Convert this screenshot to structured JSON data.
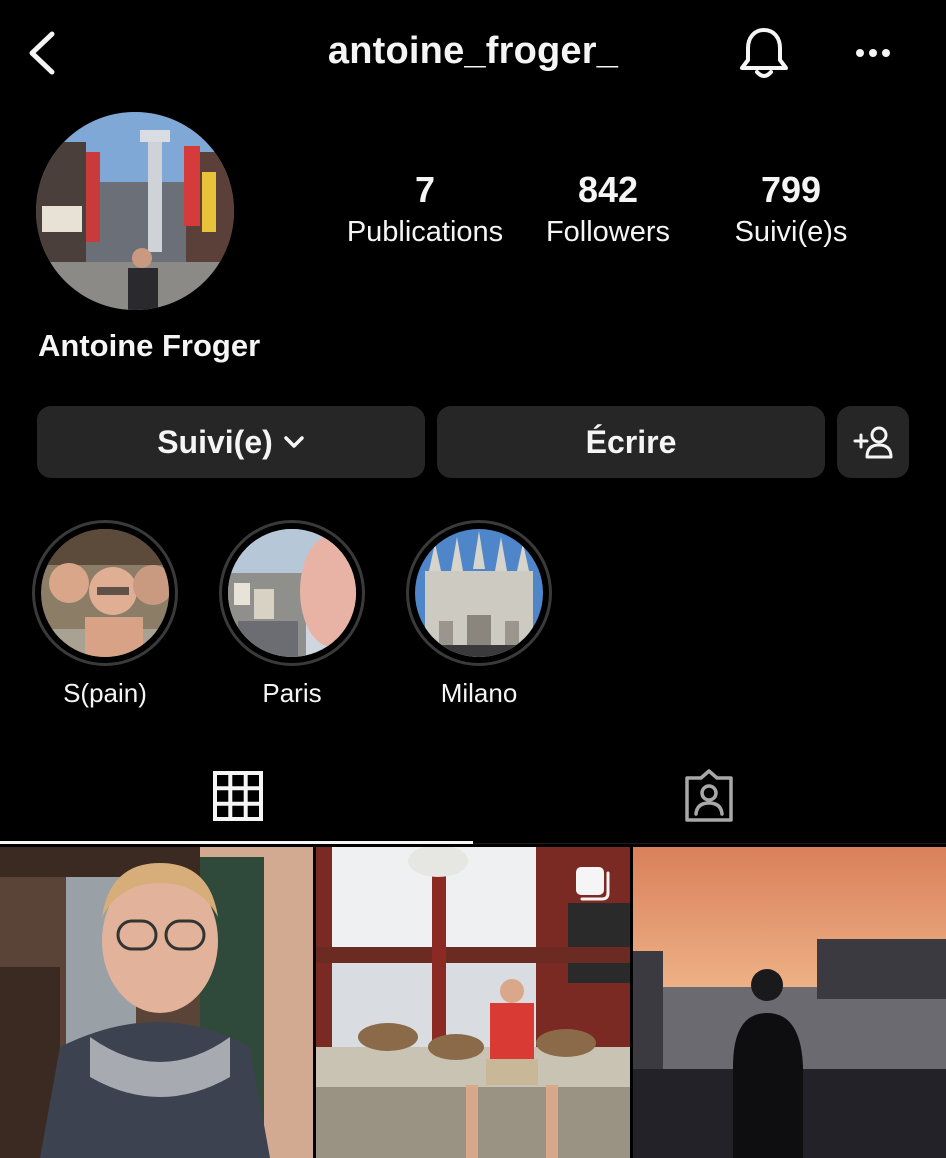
{
  "header": {
    "username": "antoine_froger_",
    "back_icon": "chevron-left-icon",
    "bell_icon": "bell-icon",
    "more_icon": "more-horizontal-icon"
  },
  "profile": {
    "display_name": "Antoine Froger",
    "stats": [
      {
        "value": "7",
        "label": "Publications"
      },
      {
        "value": "842",
        "label": "Followers"
      },
      {
        "value": "799",
        "label": "Suivi(e)s"
      }
    ]
  },
  "actions": {
    "follow_label": "Suivi(e)",
    "message_label": "Écrire",
    "add_user_icon": "add-user-icon"
  },
  "highlights": [
    {
      "label": "S(pain)"
    },
    {
      "label": "Paris"
    },
    {
      "label": "Milano"
    }
  ],
  "tabs": [
    {
      "icon": "grid-icon",
      "active": true
    },
    {
      "icon": "tagged-icon",
      "active": false
    }
  ],
  "colors": {
    "background": "#000000",
    "button": "#262626",
    "text": "#f5f5f5"
  }
}
